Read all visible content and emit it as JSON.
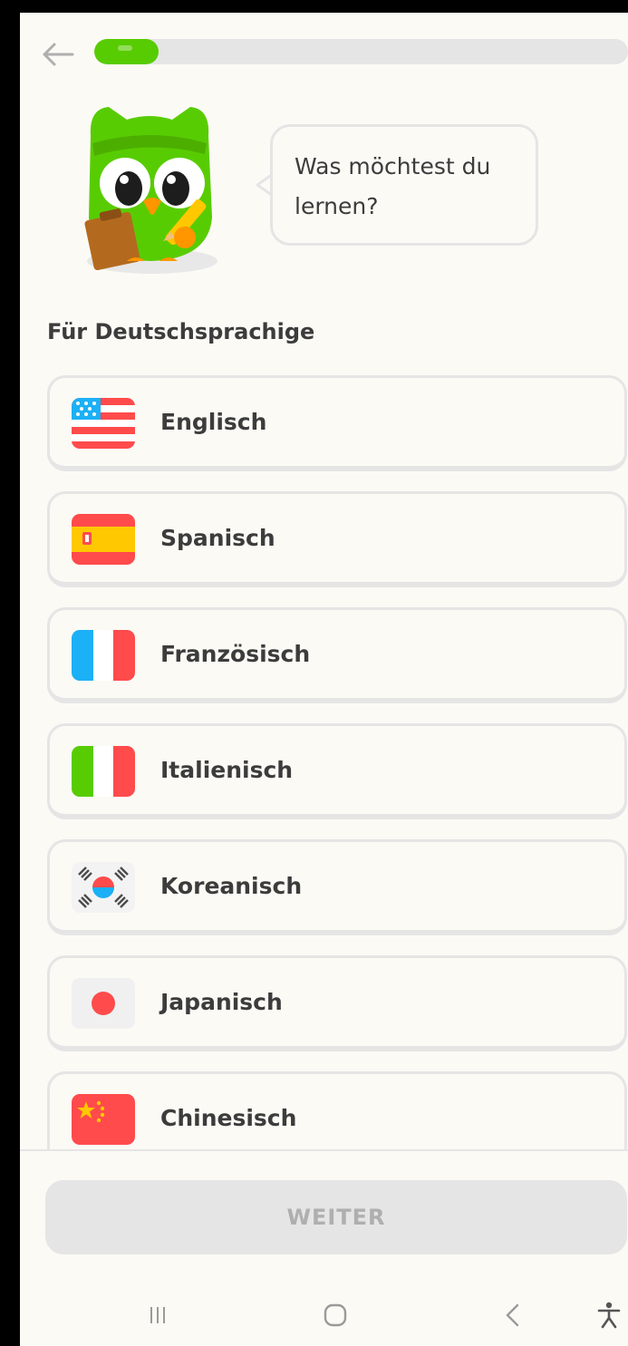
{
  "header": {
    "back_icon": "arrow-left-icon",
    "progress_fraction": 0.12
  },
  "mascot": {
    "speech": "Was möchtest du lernen?"
  },
  "section_title": "Für Deutschsprachige",
  "languages": [
    {
      "label": "Englisch",
      "flag_icon": "us-flag-icon"
    },
    {
      "label": "Spanisch",
      "flag_icon": "spain-flag-icon"
    },
    {
      "label": "Französisch",
      "flag_icon": "france-flag-icon"
    },
    {
      "label": "Italienisch",
      "flag_icon": "italy-flag-icon"
    },
    {
      "label": "Koreanisch",
      "flag_icon": "korea-flag-icon"
    },
    {
      "label": "Japanisch",
      "flag_icon": "japan-flag-icon"
    },
    {
      "label": "Chinesisch",
      "flag_icon": "china-flag-icon"
    }
  ],
  "continue_label": "WEITER",
  "nav": {
    "recents_icon": "recents-icon",
    "home_icon": "home-icon",
    "back_icon": "back-chevron-icon",
    "accessibility_icon": "accessibility-icon"
  },
  "colors": {
    "brand_green": "#58cc02",
    "background": "#fbfaf5",
    "border": "#e5e5e5",
    "text": "#3c3c3c",
    "disabled_text": "#afafaf"
  }
}
